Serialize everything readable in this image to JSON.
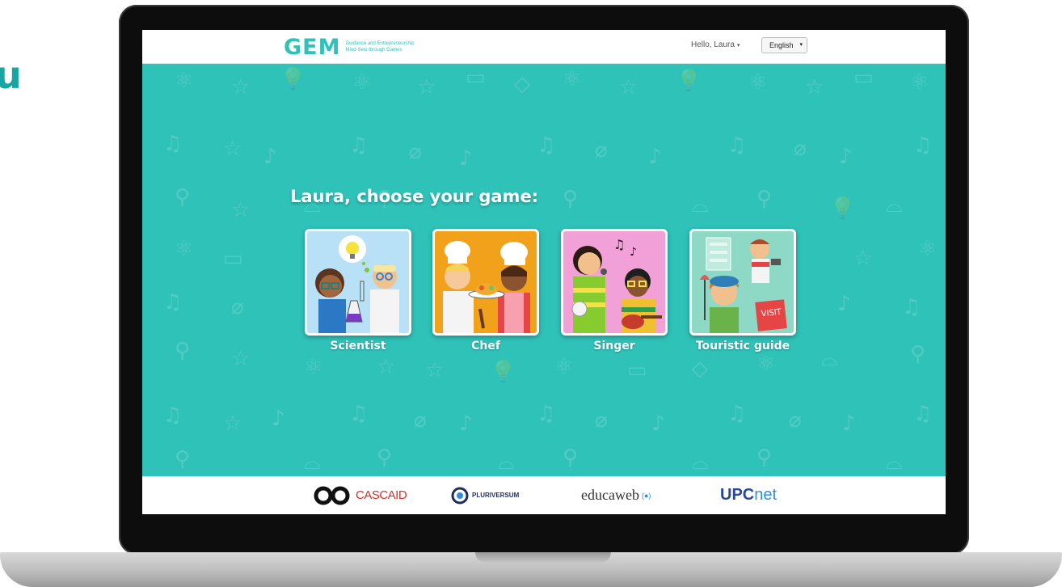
{
  "edge_text": "u",
  "header": {
    "logo_text": "GEM",
    "logo_tagline": "Guidance and Entrepreneurship Mind-Sets through Games",
    "greeting": "Hello, Laura",
    "language": "English"
  },
  "main": {
    "heading": "Laura, choose your game:",
    "games": [
      {
        "label": "Scientist",
        "bg": "#b8e0f6"
      },
      {
        "label": "Chef",
        "bg": "#f2a21a"
      },
      {
        "label": "Singer",
        "bg": "#f2a0d8"
      },
      {
        "label": "Touristic guide",
        "bg": "#8ed9c6"
      }
    ]
  },
  "footer": {
    "partners": [
      {
        "name": "CASCAID"
      },
      {
        "name": "PLURIVERSUM"
      },
      {
        "name": "educaweb",
        "mark": "(●)"
      },
      {
        "name": "UPC",
        "suffix": "net"
      }
    ]
  },
  "colors": {
    "teal": "#2ec2b9",
    "white": "#ffffff",
    "cascaid_red": "#d4302a",
    "upc_blue": "#24489a"
  }
}
